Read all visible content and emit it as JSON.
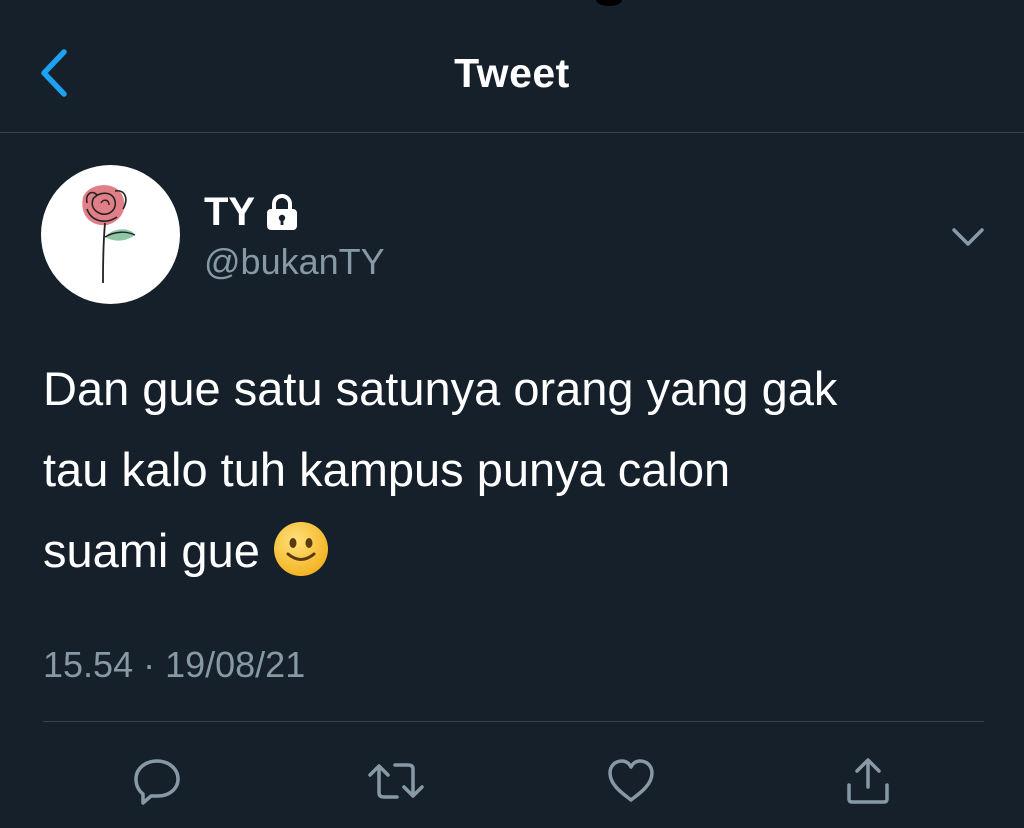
{
  "header": {
    "title": "Tweet",
    "back_icon": "chevron-left-icon"
  },
  "author": {
    "display_name": "TY",
    "handle": "@bukanTY",
    "protected_icon": "lock-icon",
    "avatar_icon": "rose-icon"
  },
  "tweet": {
    "text": "Dan gue satu satunya orang yang gak\ntau kalo tuh kampus punya calon\nsuami gue ",
    "emoji": "slightly-smiling-face-icon",
    "timestamp": "15.54 · 19/08/21",
    "menu_icon": "chevron-down-icon"
  },
  "actions": [
    {
      "icon": "reply-icon"
    },
    {
      "icon": "retweet-icon"
    },
    {
      "icon": "like-icon"
    },
    {
      "icon": "share-icon"
    }
  ],
  "colors": {
    "background": "#15202b",
    "accent": "#1da1f2",
    "secondary_text": "#8899a6",
    "divider": "#38444d"
  }
}
